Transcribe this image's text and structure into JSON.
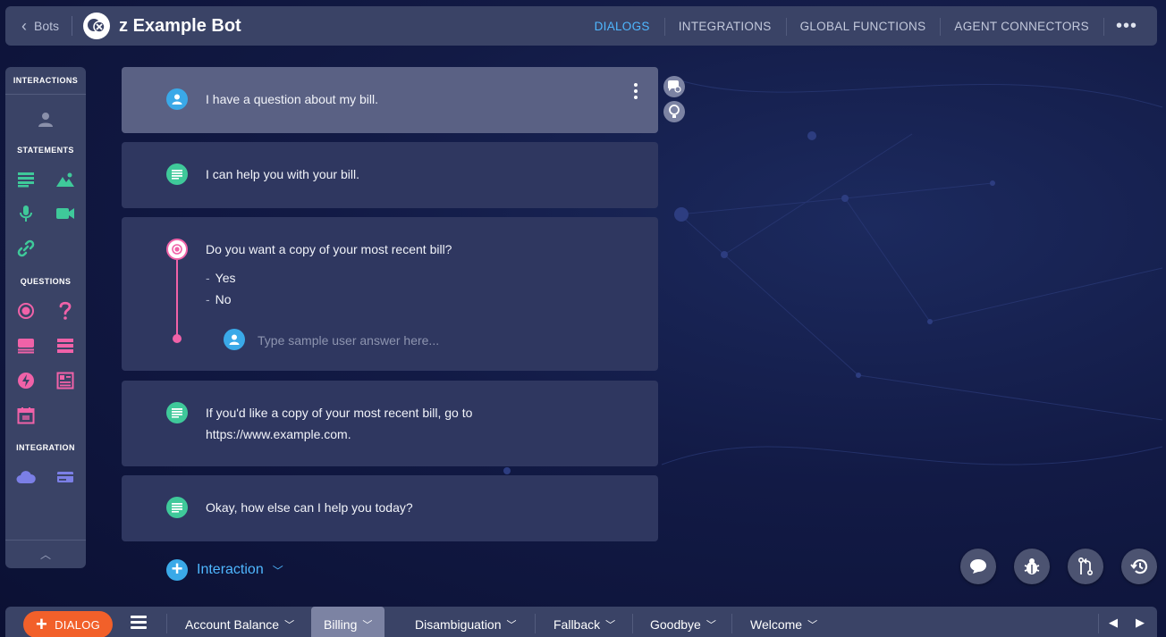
{
  "header": {
    "back_label": "Bots",
    "bot_name": "z Example Bot",
    "nav": [
      "DIALOGS",
      "INTEGRATIONS",
      "GLOBAL FUNCTIONS",
      "AGENT CONNECTORS"
    ],
    "active_nav": "DIALOGS",
    "more": "•••"
  },
  "palette": {
    "sections": [
      "INTERACTIONS",
      "STATEMENTS",
      "QUESTIONS",
      "INTEGRATION"
    ],
    "icons": {
      "interactions": [
        "user-icon"
      ],
      "statements": [
        "text-statement-icon",
        "image-statement-icon",
        "audio-statement-icon",
        "video-statement-icon",
        "link-statement-icon"
      ],
      "questions": [
        "multiple-choice-icon",
        "question-mark-icon",
        "list-picker-icon",
        "structured-list-icon",
        "quick-reply-icon",
        "form-icon",
        "date-picker-icon"
      ],
      "integration": [
        "cloud-integration-icon",
        "card-integration-icon"
      ]
    },
    "colors": {
      "user": "#8a90aa",
      "statement": "#3fc99a",
      "question": "#f062a8",
      "integration": "#7b7fe6"
    }
  },
  "interactions": [
    {
      "type": "user",
      "text": "I have a question about my bill."
    },
    {
      "type": "statement",
      "text": "I can help you with your bill."
    },
    {
      "type": "question",
      "text": "Do you want a copy of your most recent bill?",
      "options": [
        "Yes",
        "No"
      ],
      "sample_placeholder": "Type sample user answer here..."
    },
    {
      "type": "statement",
      "text_line1": "If you'd like a copy of your most recent bill, go to",
      "text_line2": "https://www.example.com."
    },
    {
      "type": "statement",
      "text": "Okay, how else can I help you today?"
    }
  ],
  "add_interaction_label": "Interaction",
  "floating_actions": [
    "chat-preview-icon",
    "debug-bug-icon",
    "version-control-icon",
    "history-icon"
  ],
  "bottom": {
    "dialog_button": "DIALOG",
    "tabs": [
      "Account Balance",
      "Billing",
      "Disambiguation",
      "Fallback",
      "Goodbye",
      "Welcome"
    ],
    "active_tab": "Billing"
  },
  "colors": {
    "accent": "#4fb7ff",
    "orange": "#f2602a",
    "question_pink": "#f062a8",
    "statement_green": "#3fc99a"
  }
}
